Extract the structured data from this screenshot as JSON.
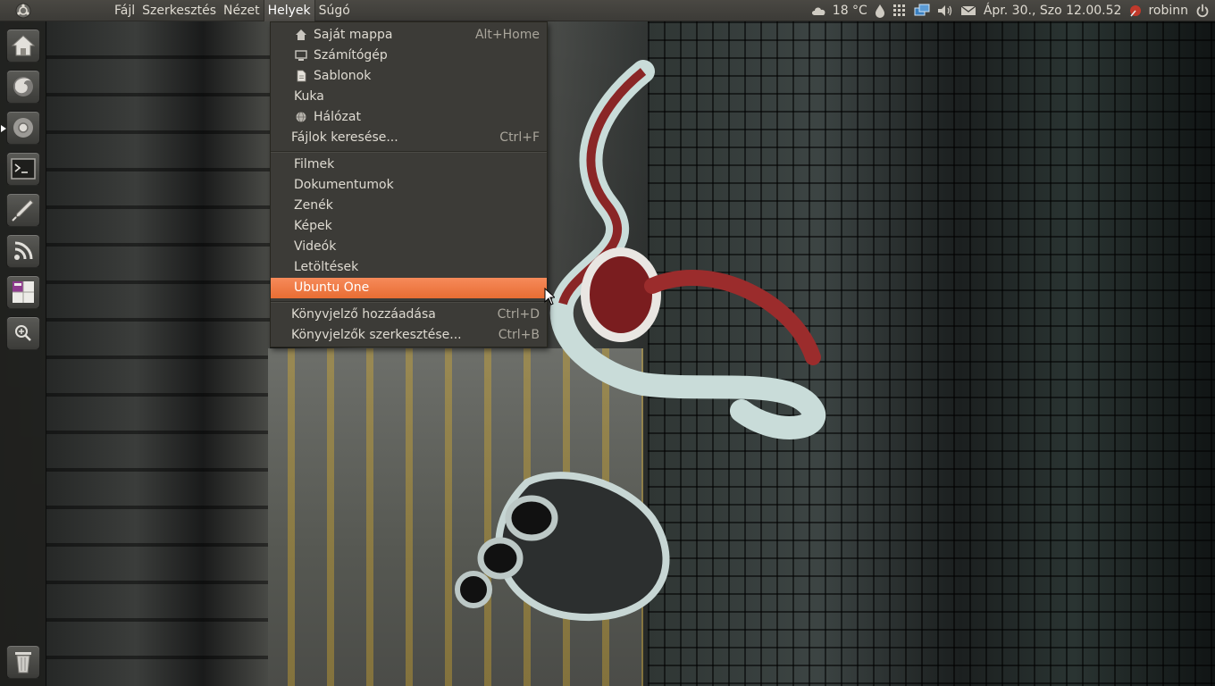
{
  "top_panel": {
    "menus": [
      {
        "label": "Fájl"
      },
      {
        "label": "Szerkesztés"
      },
      {
        "label": "Nézet"
      },
      {
        "label": "Helyek",
        "open": true
      },
      {
        "label": "Súgó"
      }
    ],
    "indicators": {
      "weather": "18 °C",
      "datetime": "Ápr. 30., Szo 12.00.52",
      "user": "robinn"
    }
  },
  "launcher": {
    "items": [
      {
        "name": "home-folder",
        "icon": "home-icon"
      },
      {
        "name": "firefox",
        "icon": "firefox-icon"
      },
      {
        "name": "chromium",
        "icon": "chromium-icon",
        "active": true
      },
      {
        "name": "terminal",
        "icon": "terminal-icon"
      },
      {
        "name": "inkscape",
        "icon": "pen-icon"
      },
      {
        "name": "feed-reader",
        "icon": "rss-icon"
      },
      {
        "name": "workspace-switcher",
        "icon": "workspaces-icon"
      },
      {
        "name": "dash-search",
        "icon": "magnifier-icon"
      },
      {
        "name": "trash",
        "icon": "trash-icon"
      }
    ]
  },
  "places_menu": {
    "items": [
      {
        "label": "Saját mappa",
        "accel": "Alt+Home",
        "icon": "home-icon"
      },
      {
        "label": "Számítógép",
        "icon": "computer-icon"
      },
      {
        "label": "Sablonok",
        "icon": "template-icon"
      },
      {
        "label": "Kuka"
      },
      {
        "label": "Hálózat",
        "icon": "network-icon"
      },
      {
        "label": "Fájlok keresése...",
        "accel": "Ctrl+F"
      }
    ],
    "bookmarks": [
      {
        "label": "Filmek"
      },
      {
        "label": "Dokumentumok"
      },
      {
        "label": "Zenék"
      },
      {
        "label": "Képek"
      },
      {
        "label": "Videók"
      },
      {
        "label": "Letöltések"
      },
      {
        "label": "Ubuntu One",
        "highlighted": true
      }
    ],
    "actions": [
      {
        "label": "Könyvjelző hozzáadása",
        "accel": "Ctrl+D"
      },
      {
        "label": "Könyvjelzők szerkesztése...",
        "accel": "Ctrl+B"
      }
    ]
  },
  "colors": {
    "panel": "#3c3b37",
    "highlight": "#e86d33",
    "text": "#dfdbd2"
  }
}
